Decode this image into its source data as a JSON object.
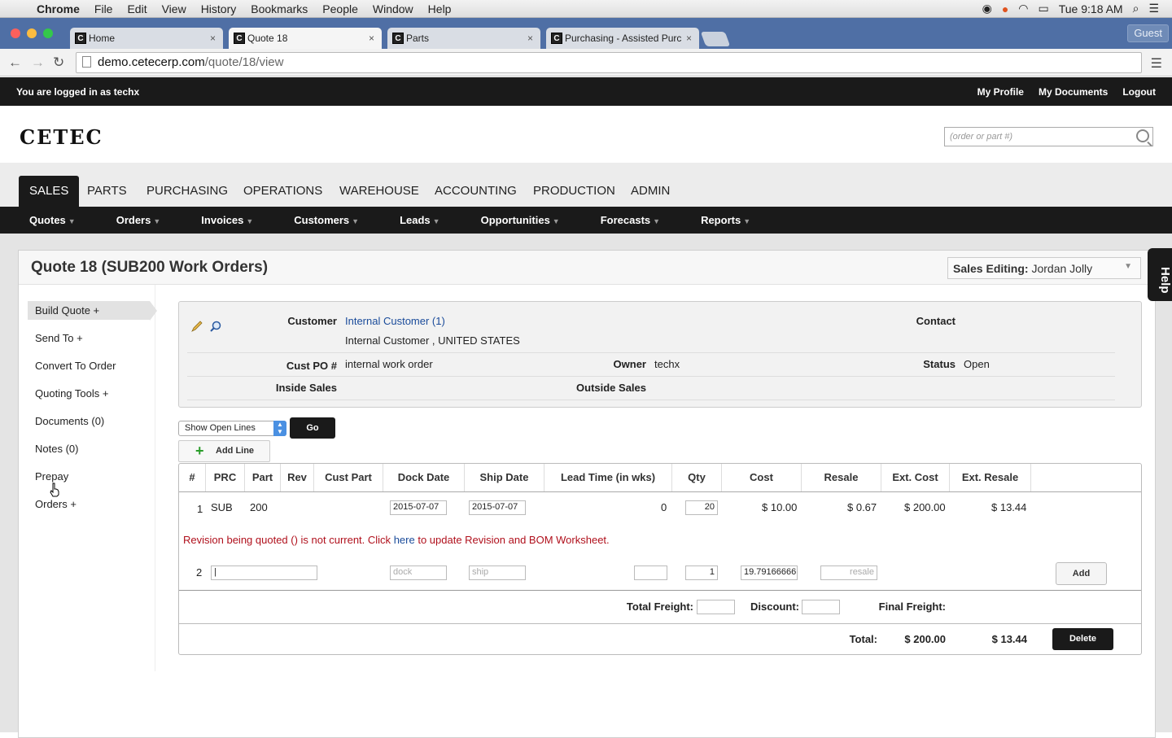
{
  "menubar": {
    "app": "Chrome",
    "items": [
      "File",
      "Edit",
      "View",
      "History",
      "Bookmarks",
      "People",
      "Window",
      "Help"
    ],
    "clock": "Tue 9:18 AM"
  },
  "tabs": [
    {
      "title": "Home"
    },
    {
      "title": "Quote 18"
    },
    {
      "title": "Parts"
    },
    {
      "title": "Purchasing - Assisted Purc"
    }
  ],
  "guest_label": "Guest",
  "url": {
    "host": "demo.cetecerp.com",
    "path": "/quote/18/view"
  },
  "topbar": {
    "logged_in": "You are logged in as techx",
    "links": [
      "My Profile",
      "My Documents",
      "Logout"
    ]
  },
  "logo": "CETEC",
  "search": {
    "placeholder": "(order or part #)"
  },
  "mainnav": [
    "SALES",
    "PARTS",
    "PURCHASING",
    "OPERATIONS",
    "WAREHOUSE",
    "ACCOUNTING",
    "PRODUCTION",
    "ADMIN"
  ],
  "subnav": [
    "Quotes",
    "Orders",
    "Invoices",
    "Customers",
    "Leads",
    "Opportunities",
    "Forecasts",
    "Reports"
  ],
  "quote": {
    "title": "Quote 18 (SUB200 Work Orders)",
    "sales_editing_label": "Sales Editing:",
    "sales_editing_value": "Jordan Jolly"
  },
  "help_label": "Help",
  "sidebar": [
    "Build Quote +",
    "Send To +",
    "Convert To Order",
    "Quoting Tools +",
    "Documents (0)",
    "Notes (0)",
    "Prepay",
    "Orders +"
  ],
  "info": {
    "customer_label": "Customer",
    "customer_value": "Internal Customer (1)",
    "customer_address": "Internal Customer , UNITED STATES",
    "contact_label": "Contact",
    "custpo_label": "Cust PO #",
    "custpo_value": "internal work order",
    "owner_label": "Owner",
    "owner_value": "techx",
    "status_label": "Status",
    "status_value": "Open",
    "inside_label": "Inside Sales",
    "outside_label": "Outside Sales"
  },
  "filter": {
    "select": "Show Open Lines",
    "go": "Go",
    "add_line": "Add Line"
  },
  "table": {
    "headers": [
      "#",
      "PRC",
      "Part",
      "Rev",
      "Cust Part",
      "Dock Date",
      "Ship Date",
      "Lead Time (in wks)",
      "Qty",
      "Cost",
      "Resale",
      "Ext. Cost",
      "Ext. Resale"
    ],
    "row1": {
      "num": "1",
      "prc": "SUB",
      "part": "200",
      "dock": "2015-07-07",
      "ship": "2015-07-07",
      "lead": "0",
      "qty": "20",
      "cost": "$ 10.00",
      "resale": "$ 0.67",
      "extcost": "$ 200.00",
      "extresale": "$ 13.44"
    },
    "warning_pre": "Revision being quoted () is not current. Click ",
    "warning_link": "here",
    "warning_post": " to update Revision and BOM Worksheet.",
    "row2": {
      "num": "2",
      "dock_ph": "dock",
      "ship_ph": "ship",
      "qty": "1",
      "cost": "19.79166666",
      "resale_ph": "resale",
      "add": "Add"
    },
    "total_freight_label": "Total Freight:",
    "discount_label": "Discount:",
    "final_freight_label": "Final Freight:",
    "total_label": "Total:",
    "total_cost": "$ 200.00",
    "total_resale": "$ 13.44",
    "delete": "Delete"
  }
}
